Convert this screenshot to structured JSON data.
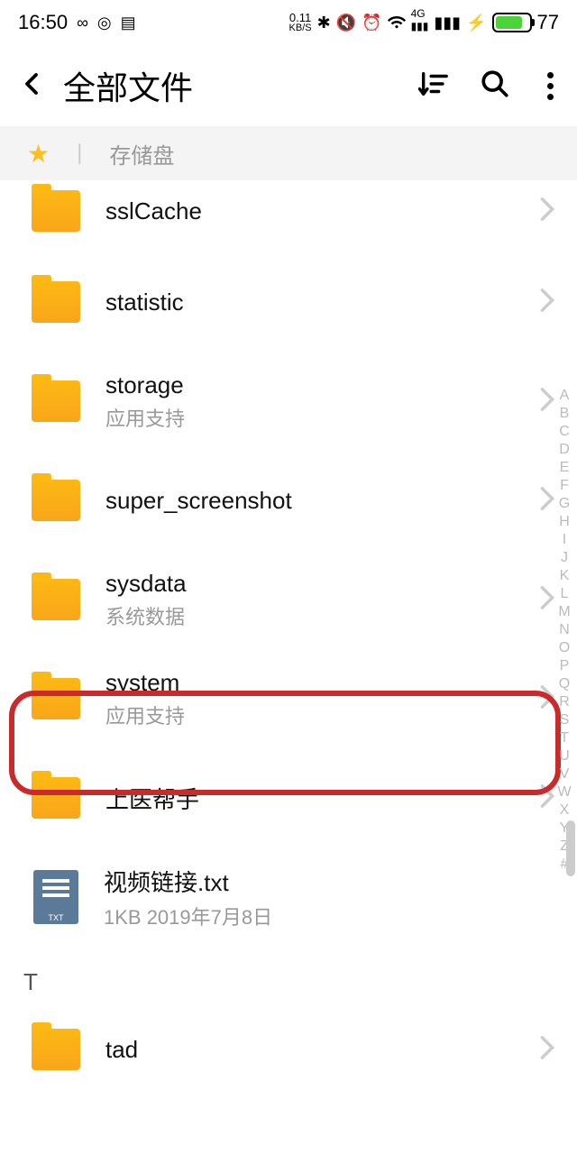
{
  "status": {
    "time": "16:50",
    "net_speed_top": "0.11",
    "net_speed_bottom": "KB/S",
    "battery_pct": "77",
    "battery_fill_pct": 77
  },
  "header": {
    "title": "全部文件"
  },
  "breadcrumb": {
    "storage": "存储盘"
  },
  "files": [
    {
      "name": "sslCache",
      "sub": ""
    },
    {
      "name": "statistic",
      "sub": ""
    },
    {
      "name": "storage",
      "sub": "应用支持"
    },
    {
      "name": "super_screenshot",
      "sub": ""
    },
    {
      "name": "sysdata",
      "sub": "系统数据"
    },
    {
      "name": "system",
      "sub": "应用支持"
    },
    {
      "name": "上医帮手",
      "sub": ""
    }
  ],
  "txt_file": {
    "name": "视频链接.txt",
    "meta": "1KB   2019年7月8日",
    "badge": "TXT"
  },
  "section_t": "T",
  "file_tad": {
    "name": "tad",
    "sub": ""
  },
  "index_letters": [
    "A",
    "B",
    "C",
    "D",
    "E",
    "F",
    "G",
    "H",
    "I",
    "J",
    "K",
    "L",
    "M",
    "N",
    "O",
    "P",
    "Q",
    "R",
    "S",
    "T",
    "U",
    "V",
    "W",
    "X",
    "Y",
    "Z",
    "#"
  ]
}
